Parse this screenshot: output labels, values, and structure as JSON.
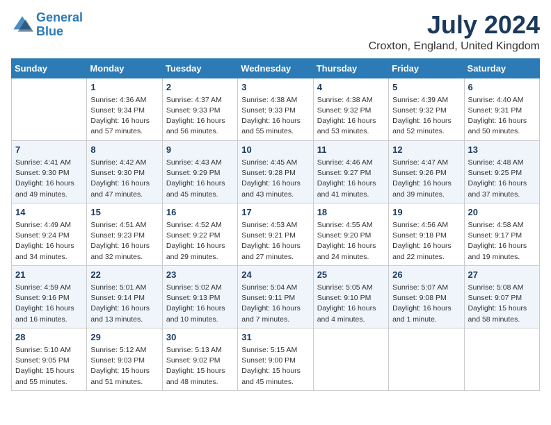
{
  "header": {
    "logo_line1": "General",
    "logo_line2": "Blue",
    "month_title": "July 2024",
    "location": "Croxton, England, United Kingdom"
  },
  "days_of_week": [
    "Sunday",
    "Monday",
    "Tuesday",
    "Wednesday",
    "Thursday",
    "Friday",
    "Saturday"
  ],
  "weeks": [
    [
      {
        "day": "",
        "empty": true
      },
      {
        "day": "1",
        "sunrise": "Sunrise: 4:36 AM",
        "sunset": "Sunset: 9:34 PM",
        "daylight": "Daylight: 16 hours and 57 minutes."
      },
      {
        "day": "2",
        "sunrise": "Sunrise: 4:37 AM",
        "sunset": "Sunset: 9:33 PM",
        "daylight": "Daylight: 16 hours and 56 minutes."
      },
      {
        "day": "3",
        "sunrise": "Sunrise: 4:38 AM",
        "sunset": "Sunset: 9:33 PM",
        "daylight": "Daylight: 16 hours and 55 minutes."
      },
      {
        "day": "4",
        "sunrise": "Sunrise: 4:38 AM",
        "sunset": "Sunset: 9:32 PM",
        "daylight": "Daylight: 16 hours and 53 minutes."
      },
      {
        "day": "5",
        "sunrise": "Sunrise: 4:39 AM",
        "sunset": "Sunset: 9:32 PM",
        "daylight": "Daylight: 16 hours and 52 minutes."
      },
      {
        "day": "6",
        "sunrise": "Sunrise: 4:40 AM",
        "sunset": "Sunset: 9:31 PM",
        "daylight": "Daylight: 16 hours and 50 minutes."
      }
    ],
    [
      {
        "day": "7",
        "sunrise": "Sunrise: 4:41 AM",
        "sunset": "Sunset: 9:30 PM",
        "daylight": "Daylight: 16 hours and 49 minutes."
      },
      {
        "day": "8",
        "sunrise": "Sunrise: 4:42 AM",
        "sunset": "Sunset: 9:30 PM",
        "daylight": "Daylight: 16 hours and 47 minutes."
      },
      {
        "day": "9",
        "sunrise": "Sunrise: 4:43 AM",
        "sunset": "Sunset: 9:29 PM",
        "daylight": "Daylight: 16 hours and 45 minutes."
      },
      {
        "day": "10",
        "sunrise": "Sunrise: 4:45 AM",
        "sunset": "Sunset: 9:28 PM",
        "daylight": "Daylight: 16 hours and 43 minutes."
      },
      {
        "day": "11",
        "sunrise": "Sunrise: 4:46 AM",
        "sunset": "Sunset: 9:27 PM",
        "daylight": "Daylight: 16 hours and 41 minutes."
      },
      {
        "day": "12",
        "sunrise": "Sunrise: 4:47 AM",
        "sunset": "Sunset: 9:26 PM",
        "daylight": "Daylight: 16 hours and 39 minutes."
      },
      {
        "day": "13",
        "sunrise": "Sunrise: 4:48 AM",
        "sunset": "Sunset: 9:25 PM",
        "daylight": "Daylight: 16 hours and 37 minutes."
      }
    ],
    [
      {
        "day": "14",
        "sunrise": "Sunrise: 4:49 AM",
        "sunset": "Sunset: 9:24 PM",
        "daylight": "Daylight: 16 hours and 34 minutes."
      },
      {
        "day": "15",
        "sunrise": "Sunrise: 4:51 AM",
        "sunset": "Sunset: 9:23 PM",
        "daylight": "Daylight: 16 hours and 32 minutes."
      },
      {
        "day": "16",
        "sunrise": "Sunrise: 4:52 AM",
        "sunset": "Sunset: 9:22 PM",
        "daylight": "Daylight: 16 hours and 29 minutes."
      },
      {
        "day": "17",
        "sunrise": "Sunrise: 4:53 AM",
        "sunset": "Sunset: 9:21 PM",
        "daylight": "Daylight: 16 hours and 27 minutes."
      },
      {
        "day": "18",
        "sunrise": "Sunrise: 4:55 AM",
        "sunset": "Sunset: 9:20 PM",
        "daylight": "Daylight: 16 hours and 24 minutes."
      },
      {
        "day": "19",
        "sunrise": "Sunrise: 4:56 AM",
        "sunset": "Sunset: 9:18 PM",
        "daylight": "Daylight: 16 hours and 22 minutes."
      },
      {
        "day": "20",
        "sunrise": "Sunrise: 4:58 AM",
        "sunset": "Sunset: 9:17 PM",
        "daylight": "Daylight: 16 hours and 19 minutes."
      }
    ],
    [
      {
        "day": "21",
        "sunrise": "Sunrise: 4:59 AM",
        "sunset": "Sunset: 9:16 PM",
        "daylight": "Daylight: 16 hours and 16 minutes."
      },
      {
        "day": "22",
        "sunrise": "Sunrise: 5:01 AM",
        "sunset": "Sunset: 9:14 PM",
        "daylight": "Daylight: 16 hours and 13 minutes."
      },
      {
        "day": "23",
        "sunrise": "Sunrise: 5:02 AM",
        "sunset": "Sunset: 9:13 PM",
        "daylight": "Daylight: 16 hours and 10 minutes."
      },
      {
        "day": "24",
        "sunrise": "Sunrise: 5:04 AM",
        "sunset": "Sunset: 9:11 PM",
        "daylight": "Daylight: 16 hours and 7 minutes."
      },
      {
        "day": "25",
        "sunrise": "Sunrise: 5:05 AM",
        "sunset": "Sunset: 9:10 PM",
        "daylight": "Daylight: 16 hours and 4 minutes."
      },
      {
        "day": "26",
        "sunrise": "Sunrise: 5:07 AM",
        "sunset": "Sunset: 9:08 PM",
        "daylight": "Daylight: 16 hours and 1 minute."
      },
      {
        "day": "27",
        "sunrise": "Sunrise: 5:08 AM",
        "sunset": "Sunset: 9:07 PM",
        "daylight": "Daylight: 15 hours and 58 minutes."
      }
    ],
    [
      {
        "day": "28",
        "sunrise": "Sunrise: 5:10 AM",
        "sunset": "Sunset: 9:05 PM",
        "daylight": "Daylight: 15 hours and 55 minutes."
      },
      {
        "day": "29",
        "sunrise": "Sunrise: 5:12 AM",
        "sunset": "Sunset: 9:03 PM",
        "daylight": "Daylight: 15 hours and 51 minutes."
      },
      {
        "day": "30",
        "sunrise": "Sunrise: 5:13 AM",
        "sunset": "Sunset: 9:02 PM",
        "daylight": "Daylight: 15 hours and 48 minutes."
      },
      {
        "day": "31",
        "sunrise": "Sunrise: 5:15 AM",
        "sunset": "Sunset: 9:00 PM",
        "daylight": "Daylight: 15 hours and 45 minutes."
      },
      {
        "day": "",
        "empty": true
      },
      {
        "day": "",
        "empty": true
      },
      {
        "day": "",
        "empty": true
      }
    ]
  ]
}
